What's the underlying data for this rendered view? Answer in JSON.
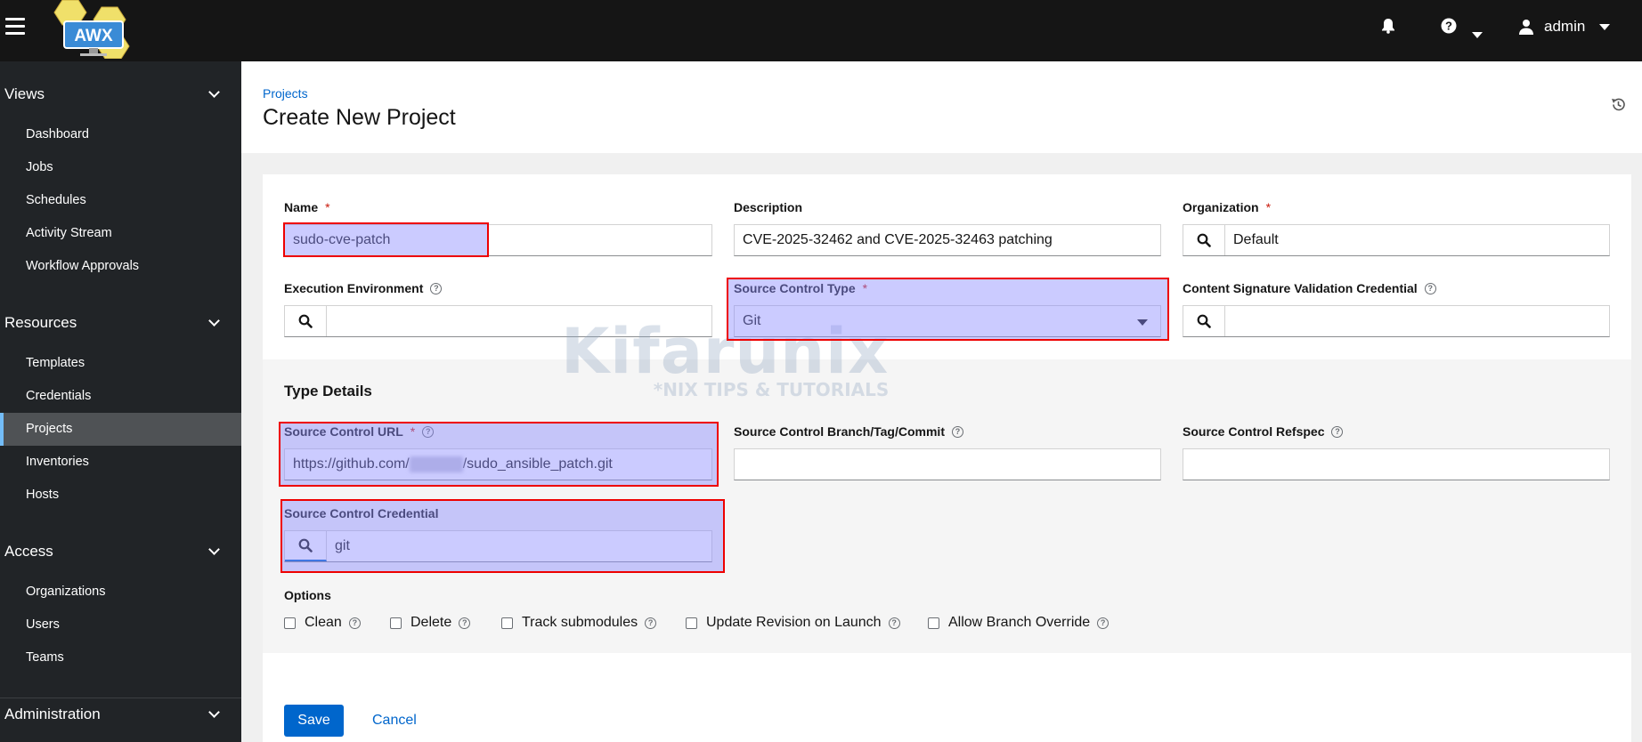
{
  "header": {
    "logo_text": "AWX",
    "user": "admin",
    "icons": [
      "bell-icon",
      "question-circle-icon",
      "user-icon"
    ]
  },
  "sidebar": {
    "groups": [
      {
        "label": "Views",
        "items": [
          "Dashboard",
          "Jobs",
          "Schedules",
          "Activity Stream",
          "Workflow Approvals"
        ]
      },
      {
        "label": "Resources",
        "items": [
          "Templates",
          "Credentials",
          "Projects",
          "Inventories",
          "Hosts"
        ]
      },
      {
        "label": "Access",
        "items": [
          "Organizations",
          "Users",
          "Teams"
        ]
      },
      {
        "label": "Administration",
        "items": []
      }
    ],
    "active_item": "Projects"
  },
  "page": {
    "breadcrumb": "Projects",
    "title": "Create New Project"
  },
  "form": {
    "name": {
      "label": "Name",
      "required": "*",
      "value": "sudo-cve-patch"
    },
    "description": {
      "label": "Description",
      "value": "CVE-2025-32462 and CVE-2025-32463 patching"
    },
    "organization": {
      "label": "Organization",
      "required": "*",
      "value": "Default"
    },
    "execution_environment": {
      "label": "Execution Environment",
      "value": ""
    },
    "source_control_type": {
      "label": "Source Control Type",
      "required": "*",
      "value": "Git"
    },
    "content_signature": {
      "label": "Content Signature Validation Credential",
      "value": ""
    },
    "type_details": {
      "title": "Type Details",
      "scm_url": {
        "label": "Source Control URL",
        "required": "*",
        "value_prefix": "https://github.com/",
        "value_suffix": "/sudo_ansible_patch.git"
      },
      "scm_branch": {
        "label": "Source Control Branch/Tag/Commit",
        "value": ""
      },
      "scm_refspec": {
        "label": "Source Control Refspec",
        "value": ""
      },
      "scm_credential": {
        "label": "Source Control Credential",
        "value": "git"
      }
    },
    "options": {
      "title": "Options",
      "items": [
        "Clean",
        "Delete",
        "Track submodules",
        "Update Revision on Launch",
        "Allow Branch Override"
      ]
    },
    "save_label": "Save",
    "cancel_label": "Cancel"
  },
  "watermark": {
    "main": "Kifarunix",
    "sub": "*NIX TIPS & TUTORIALS"
  },
  "colors": {
    "primary": "#0066cc",
    "required": "#c9190b",
    "sidebar_bg": "#212427",
    "header_bg": "#151515",
    "highlight_border": "#ee0000"
  }
}
